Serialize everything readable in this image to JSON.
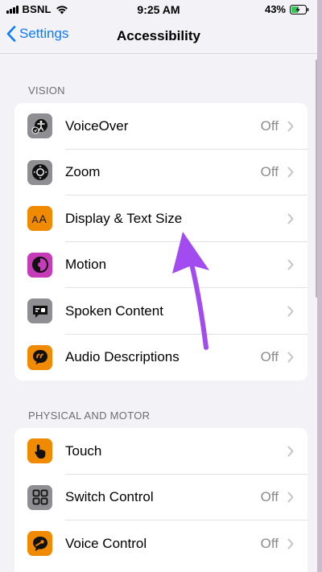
{
  "status_bar": {
    "carrier": "BSNL",
    "time": "9:25 AM",
    "battery_percent": "43%"
  },
  "nav": {
    "back_label": "Settings",
    "title": "Accessibility"
  },
  "sections": [
    {
      "header": "VISION",
      "rows": [
        {
          "label": "VoiceOver",
          "value": "Off",
          "icon": "voiceover-icon",
          "color": "#8e8e93"
        },
        {
          "label": "Zoom",
          "value": "Off",
          "icon": "zoom-icon",
          "color": "#8e8e93"
        },
        {
          "label": "Display & Text Size",
          "value": "",
          "icon": "text-size-icon",
          "color": "#f08a00"
        },
        {
          "label": "Motion",
          "value": "",
          "icon": "motion-icon",
          "color": "#c63bb8"
        },
        {
          "label": "Spoken Content",
          "value": "",
          "icon": "spoken-content-icon",
          "color": "#8e8e93"
        },
        {
          "label": "Audio Descriptions",
          "value": "Off",
          "icon": "audio-descriptions-icon",
          "color": "#f08a00"
        }
      ]
    },
    {
      "header": "PHYSICAL AND MOTOR",
      "rows": [
        {
          "label": "Touch",
          "value": "",
          "icon": "touch-icon",
          "color": "#f08a00"
        },
        {
          "label": "Switch Control",
          "value": "Off",
          "icon": "switch-control-icon",
          "color": "#8e8e93"
        },
        {
          "label": "Voice Control",
          "value": "Off",
          "icon": "voice-control-icon",
          "color": "#f08a00"
        }
      ]
    }
  ],
  "colors": {
    "accent": "#0a7aff",
    "annotation_arrow": "#a24bf0"
  }
}
